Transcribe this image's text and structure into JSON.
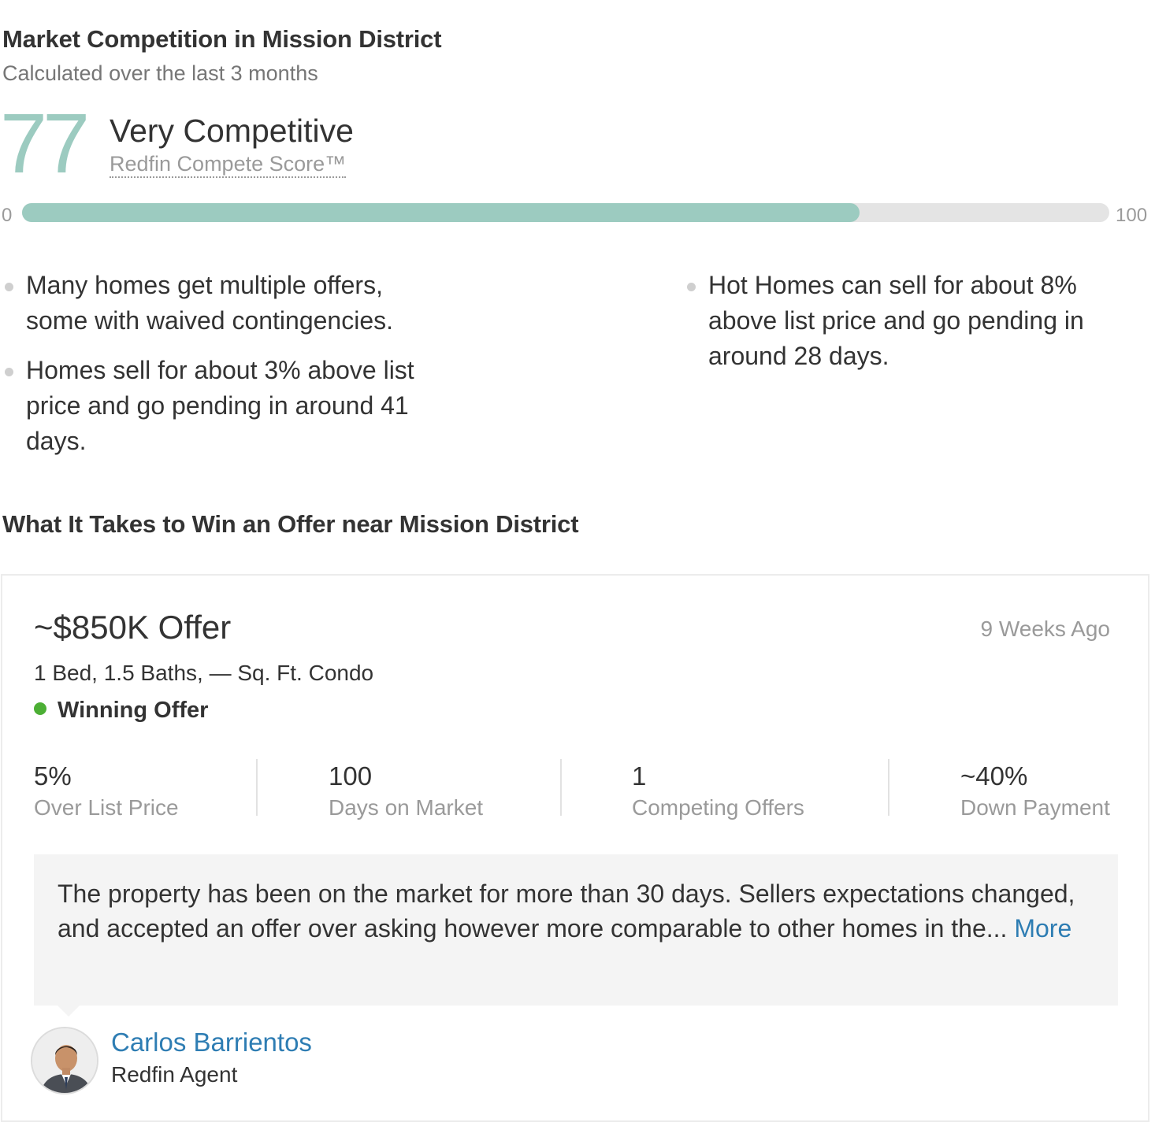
{
  "competition": {
    "title": "Market Competition in Mission District",
    "subtitle": "Calculated over the last 3 months",
    "score": "77",
    "score_value": 77,
    "score_fraction": 0.77,
    "label": "Very Competitive",
    "score_link": "Redfin Compete Score™",
    "bar_min": "0",
    "bar_max": "100",
    "accent_color": "#9ccbc0",
    "bullets_left": [
      "Many homes get multiple offers, some with waived contingencies.",
      "Homes sell for about 3% above list price and go pending in around 41 days."
    ],
    "bullets_right": [
      "Hot Homes can sell for about 8% above list price and go pending in around 28 days."
    ]
  },
  "offer_section": {
    "title": "What It Takes to Win an Offer near Mission District"
  },
  "offer_card": {
    "title": "~$850K Offer",
    "date": "9 Weeks Ago",
    "details": "1 Bed, 1.5 Baths, — Sq. Ft. Condo",
    "status": "Winning Offer",
    "status_color": "#4caf35",
    "stats": [
      {
        "value": "5%",
        "label": "Over List Price"
      },
      {
        "value": "100",
        "label": "Days on Market"
      },
      {
        "value": "1",
        "label": "Competing Offers"
      },
      {
        "value": "~40%",
        "label": "Down Payment"
      }
    ],
    "quote": "The property has been on the market for more than 30 days. Sellers expectations changed, and accepted an offer over asking however more comparable to other homes in the...",
    "more_label": "More",
    "link_color": "#2e7db3",
    "agent": {
      "name": "Carlos Barrientos",
      "role": "Redfin Agent",
      "avatar_icon": "agent-photo"
    }
  }
}
